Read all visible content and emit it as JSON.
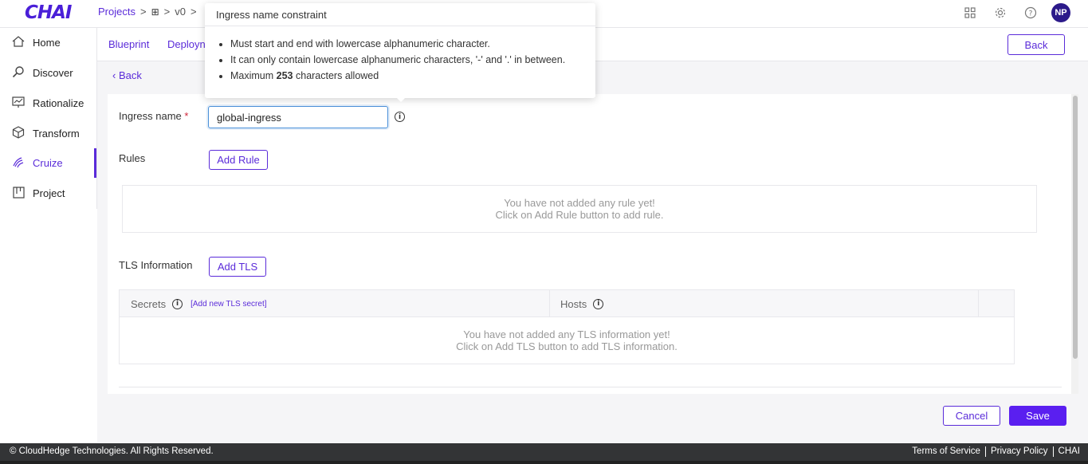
{
  "app": {
    "logo": "CHAI"
  },
  "breadcrumb": {
    "projects": "Projects",
    "sep1": ">",
    "sep2": ">",
    "version": "v0",
    "sep3": ">"
  },
  "header": {
    "avatar_initials": "NP"
  },
  "sidebar": {
    "items": [
      {
        "label": "Home"
      },
      {
        "label": "Discover"
      },
      {
        "label": "Rationalize"
      },
      {
        "label": "Transform"
      },
      {
        "label": "Cruize"
      },
      {
        "label": "Project"
      }
    ]
  },
  "subtabs": {
    "blueprint": "Blueprint",
    "deploy": "Deployn",
    "back": "Back"
  },
  "page": {
    "back_link": "‹ Back"
  },
  "form": {
    "ingress_label": "Ingress name",
    "required_mark": "*",
    "ingress_value": "global-ingress",
    "rules_label": "Rules",
    "add_rule": "Add Rule",
    "rules_empty_line1": "You have not added any rule yet!",
    "rules_empty_line2": "Click on Add Rule button to add rule.",
    "tls_label": "TLS Information",
    "add_tls": "Add TLS",
    "tls_col_secrets": "Secrets",
    "tls_add_secret_link": "[Add new TLS secret]",
    "tls_col_hosts": "Hosts",
    "tls_empty_line1": "You have not added any TLS information yet!",
    "tls_empty_line2": "Click on Add TLS button to add TLS information."
  },
  "actions": {
    "cancel": "Cancel",
    "save": "Save"
  },
  "tooltip": {
    "title": "Ingress name constraint",
    "rule1": "Must start and end with lowercase alphanumeric character.",
    "rule2": "It can only contain lowercase alphanumeric characters, '-' and '.' in between.",
    "rule3_prefix": "Maximum ",
    "rule3_number": "253",
    "rule3_suffix": " characters allowed"
  },
  "footer": {
    "copyright": "© CloudHedge Technologies. All Rights Reserved.",
    "terms": "Terms of Service",
    "privacy": "Privacy Policy",
    "brand": "CHAI"
  },
  "colors": {
    "accent": "#5a2bd9",
    "save_bg": "#5a1ff0",
    "footer_bg": "#333436"
  }
}
